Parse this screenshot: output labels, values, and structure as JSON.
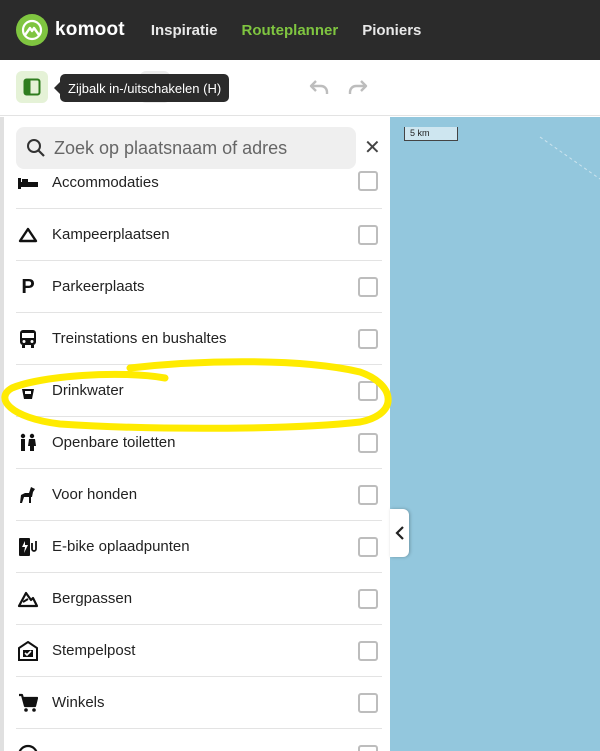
{
  "brand": {
    "name": "komoot",
    "accent": "#7fc540"
  },
  "nav": [
    {
      "label": "Inspiratie",
      "active": false
    },
    {
      "label": "Routeplanner",
      "active": true
    },
    {
      "label": "Pioniers",
      "active": false
    }
  ],
  "toolbar": {
    "tooltip": "Zijbalk in-/uitschakelen (H)"
  },
  "map": {
    "scale_label": "5 km"
  },
  "search": {
    "placeholder": "Zoek op plaatsnaam of adres"
  },
  "pois": [
    {
      "label": "Accommodaties",
      "icon": "bed-icon",
      "checked": false
    },
    {
      "label": "Kampeerplaatsen",
      "icon": "tent-icon",
      "checked": false
    },
    {
      "label": "Parkeerplaats",
      "icon": "parking-icon",
      "checked": false
    },
    {
      "label": "Treinstations en bushaltes",
      "icon": "bus-icon",
      "checked": false
    },
    {
      "label": "Drinkwater",
      "icon": "tap-icon",
      "checked": false
    },
    {
      "label": "Openbare toiletten",
      "icon": "toilet-icon",
      "checked": false
    },
    {
      "label": "Voor honden",
      "icon": "dog-icon",
      "checked": false
    },
    {
      "label": "E-bike oplaadpunten",
      "icon": "charging-icon",
      "checked": false
    },
    {
      "label": "Bergpassen",
      "icon": "mountain-icon",
      "checked": false
    },
    {
      "label": "Stempelpost",
      "icon": "stamp-icon",
      "checked": false
    },
    {
      "label": "Winkels",
      "icon": "cart-icon",
      "checked": false
    }
  ]
}
